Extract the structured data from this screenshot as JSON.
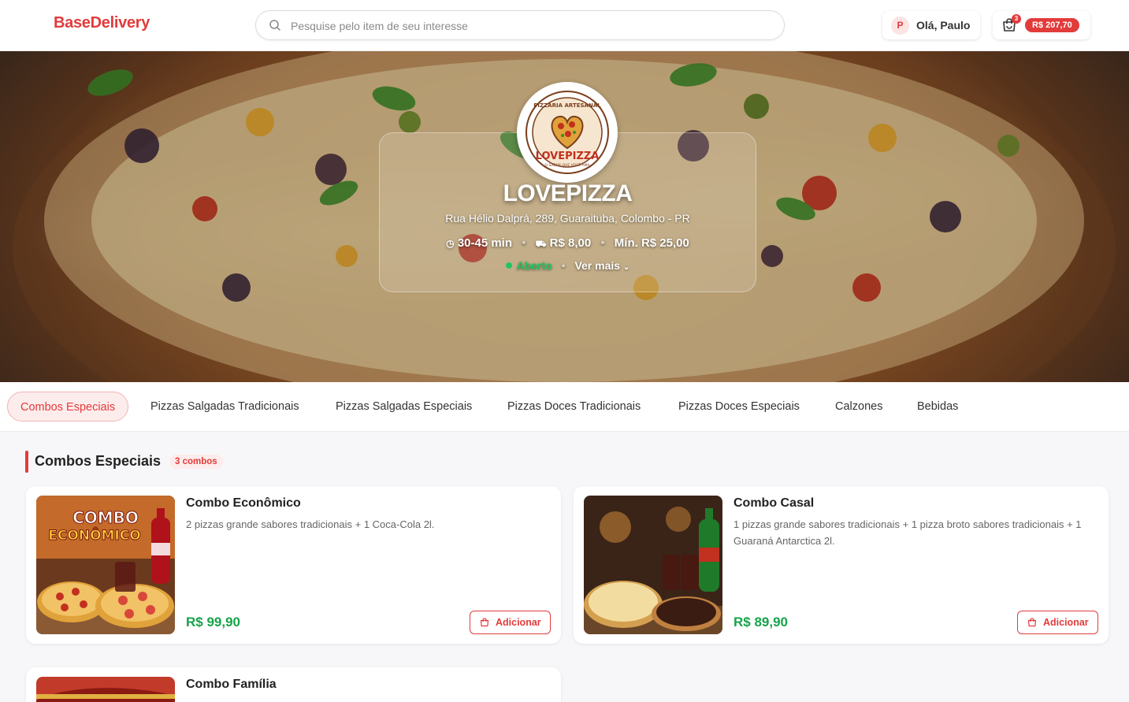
{
  "header": {
    "logo": "BaseDelivery",
    "search_placeholder": "Pesquise pelo item de seu interesse",
    "user_initial": "P",
    "greeting": "Olá, Paulo",
    "cart_count": "3",
    "cart_total": "R$ 207,70"
  },
  "store": {
    "name": "LOVEPIZZA",
    "address": "Rua Hélio Dalprá, 289, Guaraituba, Colombo - PR",
    "delivery_time": "30-45 min",
    "delivery_fee": "R$ 8,00",
    "minimum": "Mín. R$ 25,00",
    "status": "Aberto",
    "more": "Ver mais",
    "logo_text_top": "PIZZARIA ARTESANAL",
    "logo_text_main": "LOVEPIZZA",
    "logo_text_bottom": "O SABOR QUE VOCÊ AMA"
  },
  "tabs": [
    {
      "label": "Combos Especiais",
      "active": true
    },
    {
      "label": "Pizzas Salgadas Tradicionais"
    },
    {
      "label": "Pizzas Salgadas Especiais"
    },
    {
      "label": "Pizzas Doces Tradicionais"
    },
    {
      "label": "Pizzas Doces Especiais"
    },
    {
      "label": "Calzones"
    },
    {
      "label": "Bebidas"
    }
  ],
  "section": {
    "title": "Combos Especiais",
    "count": "3 combos"
  },
  "products": [
    {
      "name": "Combo Econômico",
      "description": "2 pizzas grande sabores tradicionais + 1 Coca-Cola 2l.",
      "price": "R$ 99,90",
      "add_label": "Adicionar",
      "image_text": [
        "COMBO",
        "ECONÔMICO"
      ]
    },
    {
      "name": "Combo Casal",
      "description": "1 pizzas grande sabores tradicionais + 1 pizza broto sabores tradicionais + 1 Guaraná Antarctica 2l.",
      "price": "R$ 89,90",
      "add_label": "Adicionar"
    },
    {
      "name": "Combo Família"
    }
  ],
  "colors": {
    "brand": "#e23b3b",
    "price": "#16a34a",
    "open": "#22c55e"
  }
}
